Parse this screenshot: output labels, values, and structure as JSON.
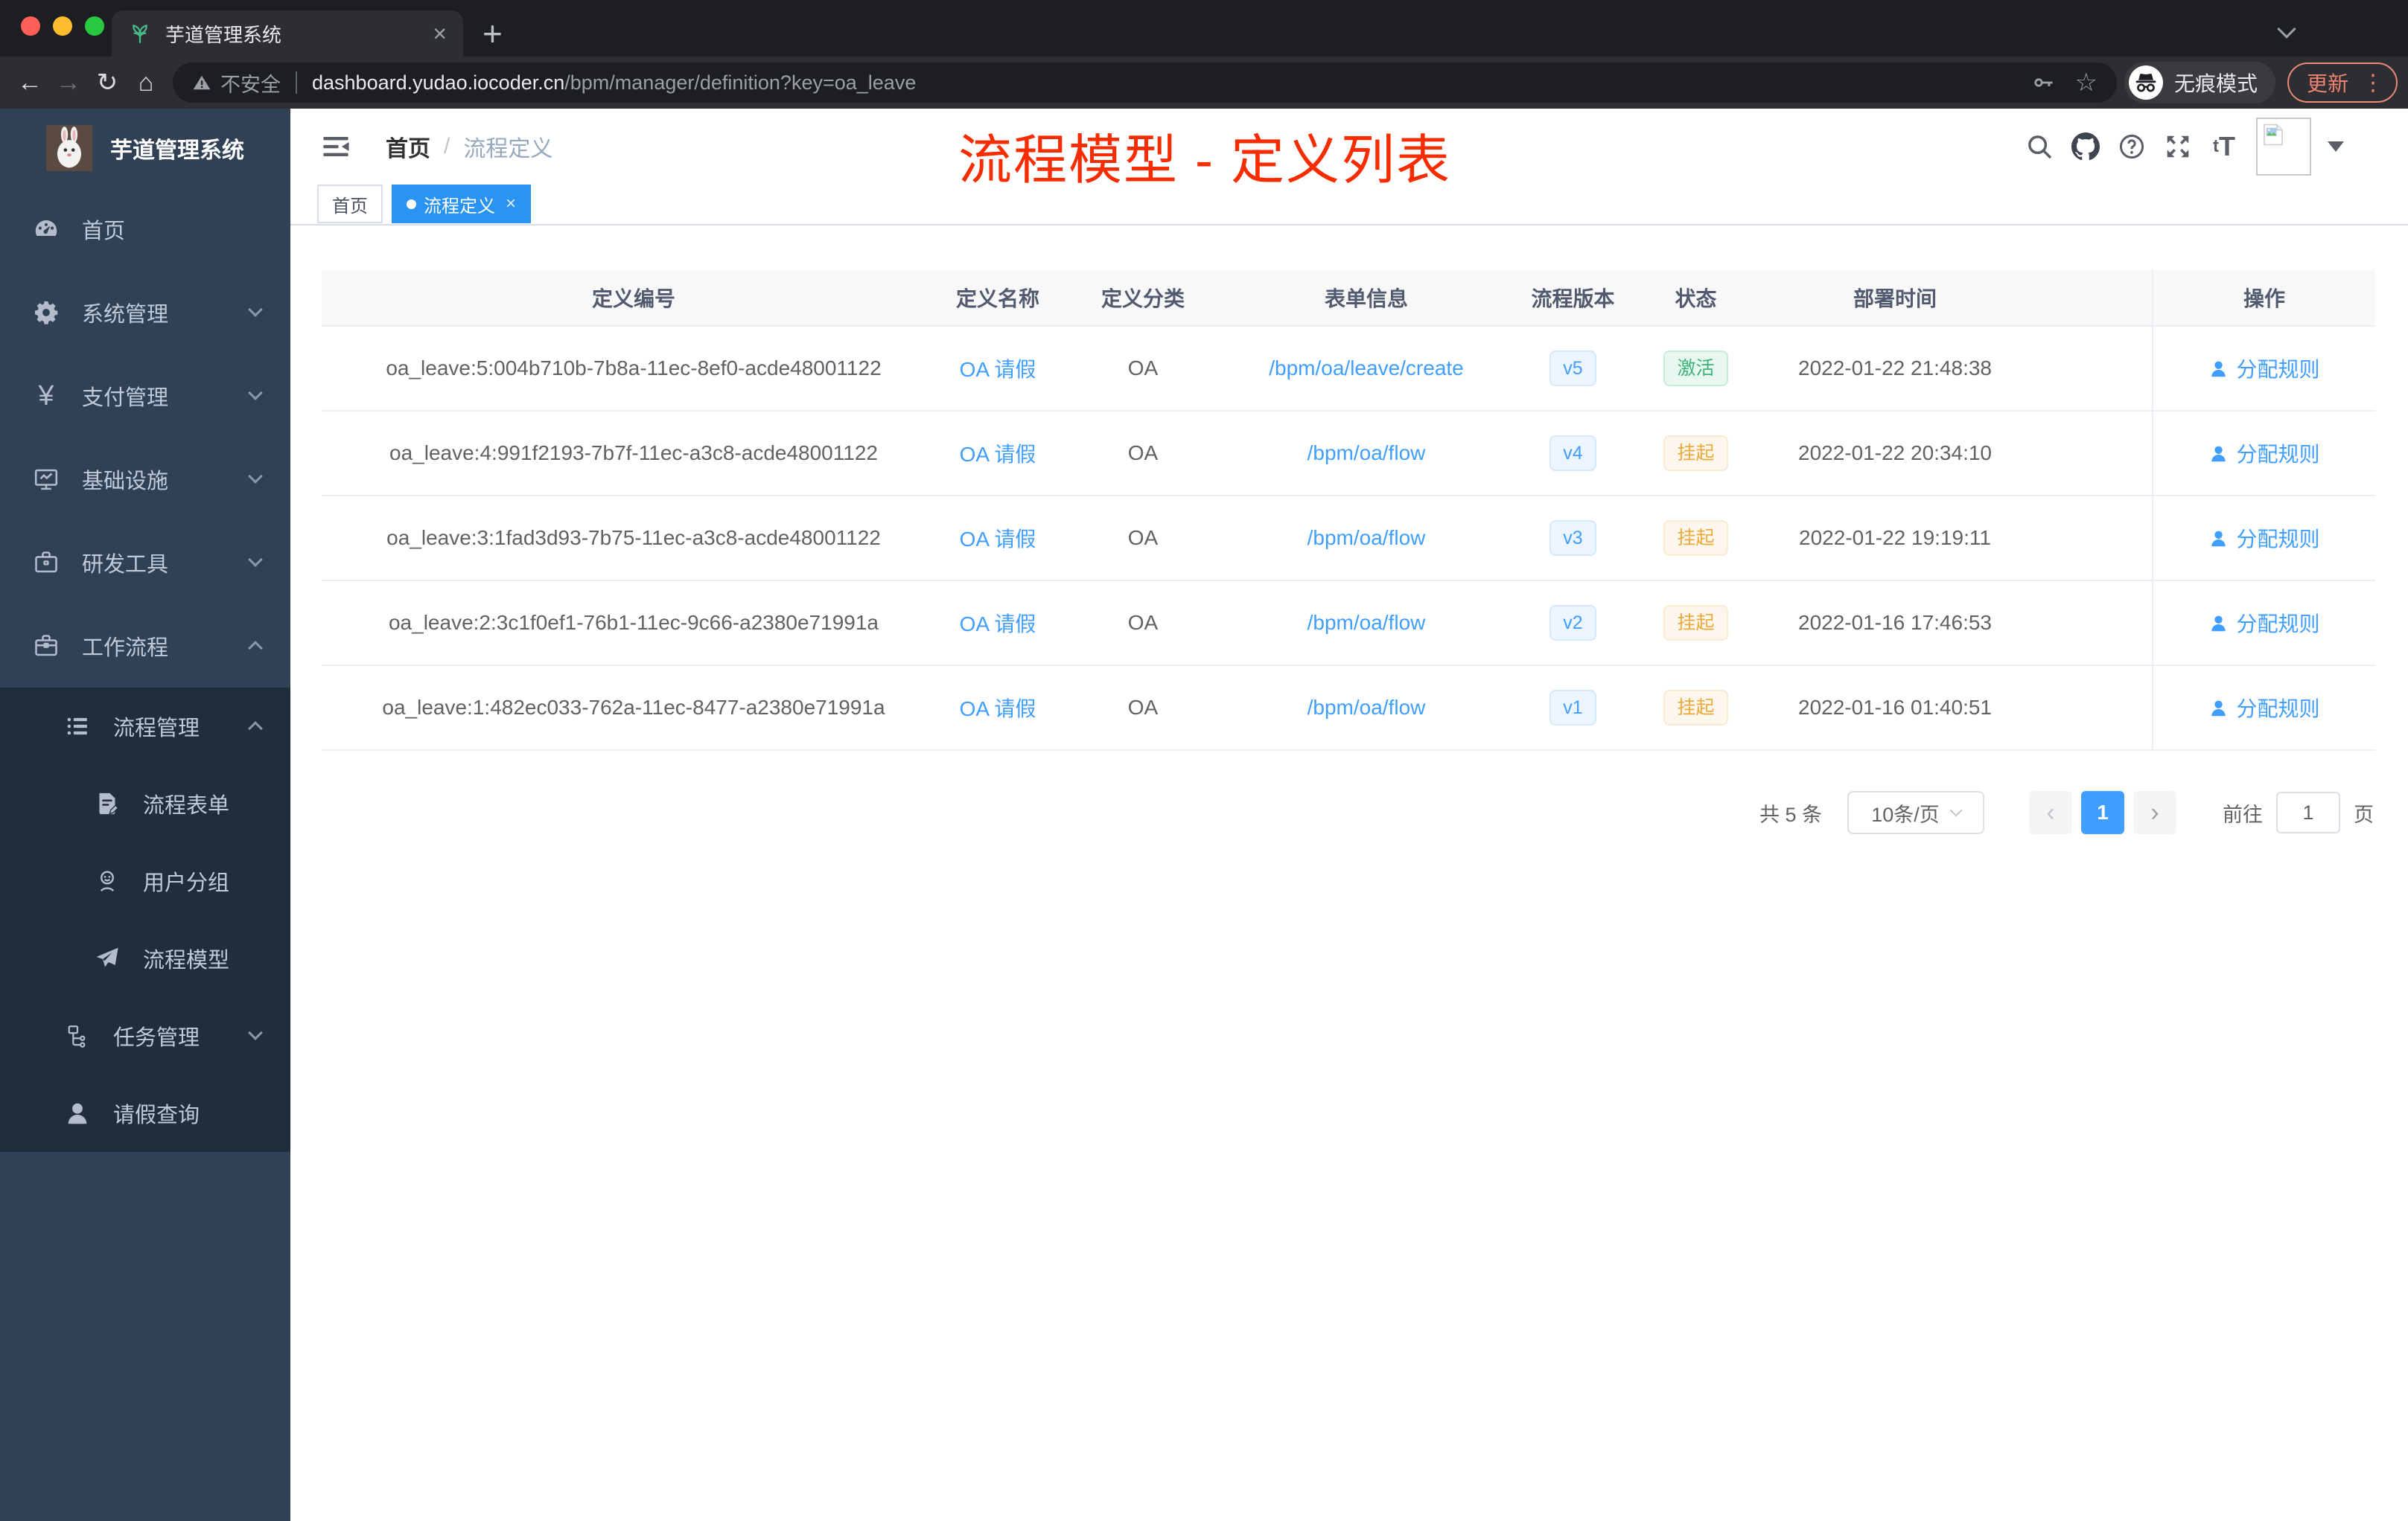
{
  "browser": {
    "tab": {
      "title": "芋道管理系统",
      "close": "×",
      "new_tab": "+"
    },
    "toolbar": {
      "back": "←",
      "forward": "→",
      "reload": "↻",
      "home": "⌂",
      "security_label": "不安全",
      "url_host": "dashboard.yudao.iocoder.cn",
      "url_path": "/bpm/manager/definition?key=oa_leave",
      "star": "☆",
      "incognito_label": "无痕模式",
      "update_label": "更新",
      "menu_dots": "⋮"
    }
  },
  "sidebar": {
    "logo_title": "芋道管理系统",
    "items": [
      {
        "label": "首页",
        "icon": "dashboard-icon",
        "level": 0
      },
      {
        "label": "系统管理",
        "icon": "gear-icon",
        "level": 0,
        "chevron": "down"
      },
      {
        "label": "支付管理",
        "icon": "yen-icon",
        "level": 0,
        "chevron": "down"
      },
      {
        "label": "基础设施",
        "icon": "monitor-icon",
        "level": 0,
        "chevron": "down"
      },
      {
        "label": "研发工具",
        "icon": "toolbox-icon",
        "level": 0,
        "chevron": "down"
      },
      {
        "label": "工作流程",
        "icon": "briefcase-icon",
        "level": 0,
        "chevron": "up"
      },
      {
        "label": "流程管理",
        "icon": "list-icon",
        "level": 1,
        "chevron": "up",
        "dark": true
      },
      {
        "label": "流程表单",
        "icon": "form-icon",
        "level": 2,
        "dark": true
      },
      {
        "label": "用户分组",
        "icon": "user-group-icon",
        "level": 2,
        "dark": true
      },
      {
        "label": "流程模型",
        "icon": "paper-plane-icon",
        "level": 2,
        "dark": true
      },
      {
        "label": "任务管理",
        "icon": "tree-icon",
        "level": 1,
        "chevron": "down",
        "dark": true
      },
      {
        "label": "请假查询",
        "icon": "person-icon",
        "level": 1,
        "dark": true
      }
    ]
  },
  "header": {
    "breadcrumb_home": "首页",
    "breadcrumb_separator": "/",
    "breadcrumb_current": "流程定义",
    "annotation": "流程模型 - 定义列表"
  },
  "tags": [
    {
      "label": "首页",
      "active": false
    },
    {
      "label": "流程定义",
      "active": true,
      "closable": true
    }
  ],
  "table": {
    "columns": [
      "定义编号",
      "定义名称",
      "定义分类",
      "表单信息",
      "流程版本",
      "状态",
      "部署时间",
      "操作"
    ],
    "action_label": "分配规则",
    "rows": [
      {
        "id": "oa_leave:5:004b710b-7b8a-11ec-8ef0-acde48001122",
        "name": "OA 请假",
        "category": "OA",
        "form": "/bpm/oa/leave/create",
        "version": "v5",
        "status": "激活",
        "status_type": "success",
        "deploy_time": "2022-01-22 21:48:38"
      },
      {
        "id": "oa_leave:4:991f2193-7b7f-11ec-a3c8-acde48001122",
        "name": "OA 请假",
        "category": "OA",
        "form": "/bpm/oa/flow",
        "version": "v4",
        "status": "挂起",
        "status_type": "warning",
        "deploy_time": "2022-01-22 20:34:10"
      },
      {
        "id": "oa_leave:3:1fad3d93-7b75-11ec-a3c8-acde48001122",
        "name": "OA 请假",
        "category": "OA",
        "form": "/bpm/oa/flow",
        "version": "v3",
        "status": "挂起",
        "status_type": "warning",
        "deploy_time": "2022-01-22 19:19:11"
      },
      {
        "id": "oa_leave:2:3c1f0ef1-76b1-11ec-9c66-a2380e71991a",
        "name": "OA 请假",
        "category": "OA",
        "form": "/bpm/oa/flow",
        "version": "v2",
        "status": "挂起",
        "status_type": "warning",
        "deploy_time": "2022-01-16 17:46:53"
      },
      {
        "id": "oa_leave:1:482ec033-762a-11ec-8477-a2380e71991a",
        "name": "OA 请假",
        "category": "OA",
        "form": "/bpm/oa/flow",
        "version": "v1",
        "status": "挂起",
        "status_type": "warning",
        "deploy_time": "2022-01-16 01:40:51"
      }
    ]
  },
  "pagination": {
    "total": "共 5 条",
    "page_size": "10条/页",
    "prev": "‹",
    "next": "›",
    "current_page": "1",
    "goto_label": "前往",
    "goto_value": "1",
    "page_unit": "页"
  },
  "colors": {
    "accent_blue": "#409eff",
    "tag_active_blue": "#2a94f4",
    "annotation_red": "#f72c00",
    "success_green": "#3cb479",
    "warning_orange": "#eda93c",
    "sidebar_bg": "#304156",
    "submenu_bg": "#1f2d3d"
  }
}
